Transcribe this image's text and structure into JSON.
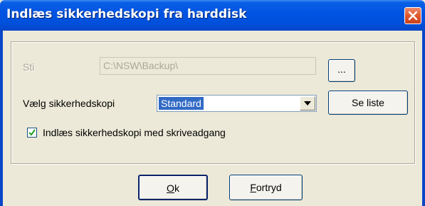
{
  "window": {
    "title": "Indlæs sikkerhedskopi fra harddisk",
    "close_icon": "close-icon"
  },
  "path": {
    "label": "Sti",
    "value": "C:\\NSW\\Backup\\",
    "browse_label": "..."
  },
  "backup_select": {
    "label": "Vælg sikkerhedskopi",
    "selected": "Standard",
    "arrow_icon": "chevron-down-icon",
    "list_button_label": "Se liste"
  },
  "write_access": {
    "checked": true,
    "label": "Indlæs sikkerhedskopi med skriveadgang"
  },
  "buttons": {
    "ok_mnemonic": "O",
    "ok_rest": "k",
    "cancel_mnemonic": "F",
    "cancel_rest": "ortryd"
  },
  "colors": {
    "titlebar": "#0053E1",
    "close": "#E2582E",
    "selection": "#316AC5",
    "dialog_bg": "#ECE9D8"
  }
}
